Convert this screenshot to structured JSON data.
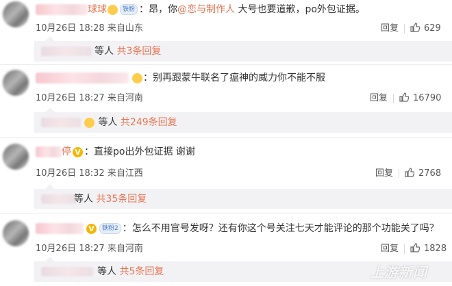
{
  "comments": [
    {
      "name_suffix": "球球",
      "badge": "铁粉",
      "body_prefix": "：昂，你",
      "mention": "@恋与制作人",
      "body_suffix": " 大号也要道歉，po外包证据。",
      "date": "10月26日",
      "time": "18:28",
      "source": "来自山东",
      "reply_label": "回复",
      "likes": "629",
      "sub_people": "等人",
      "sub_count": "共3条回复"
    },
    {
      "name_suffix": "",
      "badge": "",
      "body_prefix": "：别再跟蒙牛联名了瘟神的威力你不能不服",
      "mention": "",
      "body_suffix": "",
      "date": "10月26日",
      "time": "18:27",
      "source": "来自河南",
      "reply_label": "回复",
      "likes": "16790",
      "sub_people": "等人",
      "sub_count": "共249条回复"
    },
    {
      "name_suffix": "停",
      "badge": "",
      "body_prefix": "：直接po出外包证据 谢谢",
      "mention": "",
      "body_suffix": "",
      "date": "10月26日",
      "time": "18:32",
      "source": "来自江西",
      "reply_label": "回复",
      "likes": "2768",
      "sub_people": "等人",
      "sub_count": "共35条回复"
    },
    {
      "name_suffix": "",
      "badge": "铁粉2",
      "body_prefix": "：怎么不用官号发呀？还有你这个号关注七天才能评论的那个功能关了吗？",
      "mention": "",
      "body_suffix": "",
      "date": "10月26日",
      "time": "18:27",
      "source": "来自河南",
      "reply_label": "回复",
      "likes": "1828",
      "sub_people": "等人",
      "sub_count": "共5条回复"
    }
  ],
  "icons": {
    "thumb": "thumbs-up-icon",
    "verified": "vip-v-icon"
  },
  "colors": {
    "accent": "#eb7350",
    "sub_bg": "#f2f2f5"
  },
  "watermark": "上游新闻"
}
